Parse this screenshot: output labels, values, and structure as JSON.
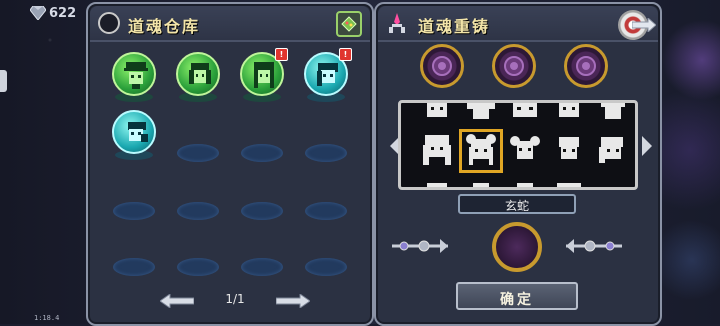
{
  "hud": {
    "gem_count": "622",
    "timer": "1:18.4"
  },
  "storage_panel": {
    "title": "道魂仓库",
    "pager": {
      "label": "1/1"
    },
    "souls": [
      {
        "color": "green",
        "has_badge": false
      },
      {
        "color": "green",
        "has_badge": false
      },
      {
        "color": "green",
        "has_badge": true
      },
      {
        "color": "teal",
        "has_badge": true
      },
      {
        "color": "teal",
        "has_badge": false
      }
    ],
    "badge_text": "!"
  },
  "recast_panel": {
    "title": "道魂重铸",
    "selected_name": "玄蛇",
    "confirm_label": "确定"
  },
  "icons": [
    "gem-icon",
    "sort-icon",
    "back-arrow-icon",
    "arrow-left-icon",
    "arrow-right-icon",
    "socket-icon",
    "ornament-icon"
  ]
}
